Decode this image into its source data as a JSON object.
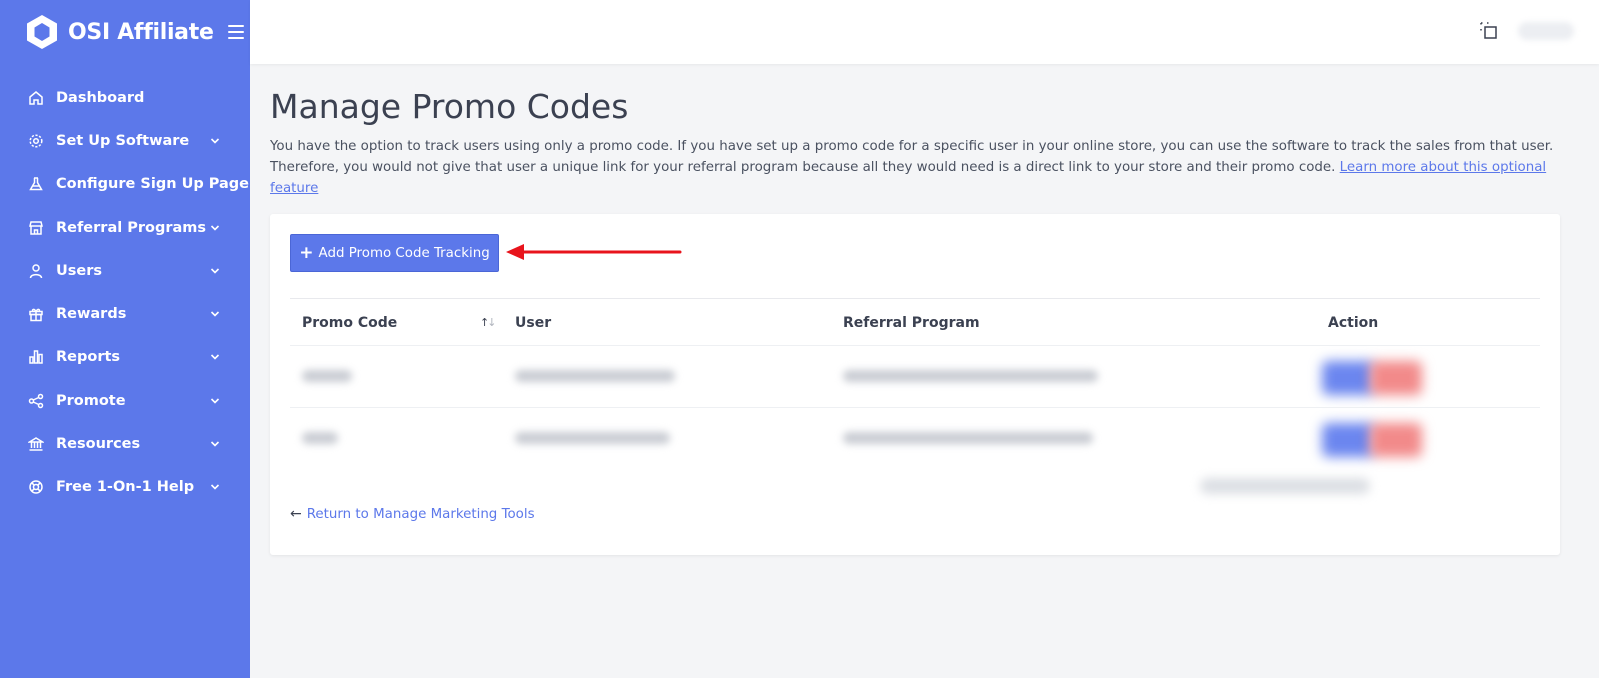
{
  "brand": {
    "name": "OSI Affiliate"
  },
  "sidebar": {
    "items": [
      {
        "label": "Dashboard",
        "icon": "home-icon",
        "has_submenu": false
      },
      {
        "label": "Set Up Software",
        "icon": "gear-icon",
        "has_submenu": true
      },
      {
        "label": "Configure Sign Up Page",
        "icon": "flask-icon",
        "has_submenu": false
      },
      {
        "label": "Referral Programs",
        "icon": "store-icon",
        "has_submenu": true
      },
      {
        "label": "Users",
        "icon": "user-icon",
        "has_submenu": true
      },
      {
        "label": "Rewards",
        "icon": "gift-icon",
        "has_submenu": true
      },
      {
        "label": "Reports",
        "icon": "bar-chart-icon",
        "has_submenu": true
      },
      {
        "label": "Promote",
        "icon": "share-icon",
        "has_submenu": true
      },
      {
        "label": "Resources",
        "icon": "bank-icon",
        "has_submenu": true
      },
      {
        "label": "Free 1-On-1 Help",
        "icon": "lifebuoy-icon",
        "has_submenu": true
      }
    ]
  },
  "page": {
    "title": "Manage Promo Codes",
    "description": "You have the option to track users using only a promo code. If you have set up a promo code for a specific user in your online store, you can use the software to track the sales from that user. Therefore, you would not give that user a unique link for your referral program because all they would need is a direct link to your store and their promo code.",
    "learn_more_label": "Learn more about this optional feature"
  },
  "card": {
    "add_button_label": "Add Promo Code Tracking",
    "table": {
      "columns": [
        "Promo Code",
        "User",
        "Referral Program",
        "Action"
      ]
    },
    "back_link_label": "Return to Manage Marketing Tools"
  },
  "colors": {
    "sidebar_bg": "#5c78ea",
    "accent": "#5c78ea",
    "annotation_arrow": "#e8141c"
  }
}
